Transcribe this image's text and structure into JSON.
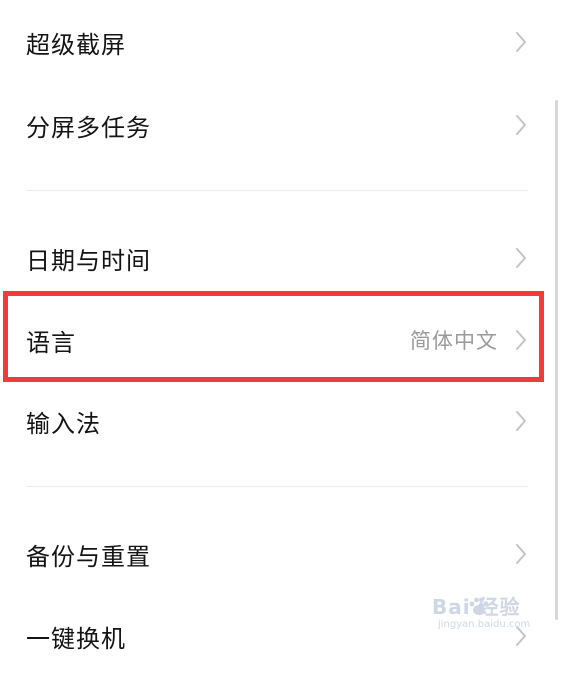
{
  "settings": {
    "items": [
      {
        "label": "超级截屏",
        "value": ""
      },
      {
        "label": "分屏多任务",
        "value": ""
      },
      {
        "label": "日期与时间",
        "value": ""
      },
      {
        "label": "语言",
        "value": "简体中文"
      },
      {
        "label": "输入法",
        "value": ""
      },
      {
        "label": "备份与重置",
        "value": ""
      },
      {
        "label": "一键换机",
        "value": ""
      }
    ]
  },
  "watermark": {
    "main": "Bai 经验",
    "sub": "jingyan.baidu.com"
  },
  "colors": {
    "highlight": "#ef3b3b",
    "label": "#141414",
    "value": "#9a9a9a",
    "chevron": "#c4c4c4"
  },
  "icons": {
    "row_arrow": "chevron-right-icon",
    "watermark_logo": "baidu-paw-icon"
  }
}
